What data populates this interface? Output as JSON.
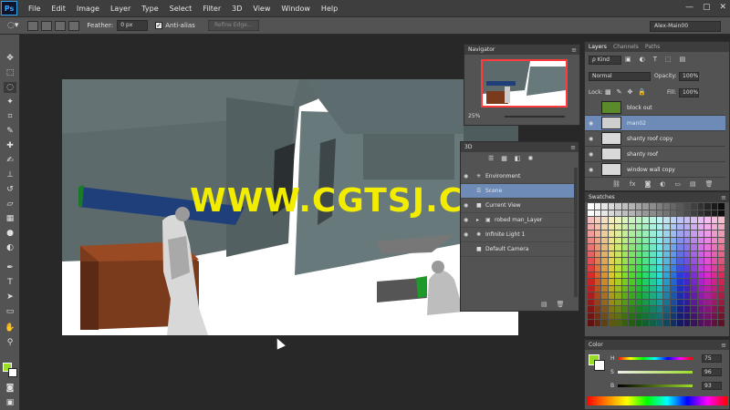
{
  "app": {
    "logo": "Ps"
  },
  "menu": [
    "File",
    "Edit",
    "Image",
    "Layer",
    "Type",
    "Select",
    "Filter",
    "3D",
    "View",
    "Window",
    "Help"
  ],
  "window_controls": [
    "—",
    "▢",
    "✕"
  ],
  "options": {
    "feather_label": "Feather:",
    "feather_value": "0 px",
    "antialias_label": "Anti-alias",
    "refine_label": "Refine Edge...",
    "workspace": "Alex-Main00"
  },
  "navigator": {
    "tab": "Navigator",
    "zoom": "25%"
  },
  "panel3d": {
    "tab": "3D",
    "rows": [
      {
        "label": "Environment",
        "icon": "globe-icon"
      },
      {
        "label": "Scene",
        "icon": "scene-icon"
      },
      {
        "label": "Current View",
        "icon": "camera-icon"
      },
      {
        "label": "robed man_Layer",
        "icon": "mesh-icon"
      },
      {
        "label": "Infinite Light 1",
        "icon": "light-icon"
      },
      {
        "label": "Default Camera",
        "icon": "camera-icon"
      }
    ]
  },
  "layers": {
    "tabs": [
      "Layers",
      "Channels",
      "Paths"
    ],
    "kind": "ρ Kind",
    "blend_mode": "Normal",
    "opacity_label": "Opacity:",
    "opacity": "100%",
    "lock_label": "Lock:",
    "fill_label": "Fill:",
    "fill": "100%",
    "rows": [
      {
        "name": "block out",
        "visible": false
      },
      {
        "name": "man02",
        "visible": true
      },
      {
        "name": "shanty roof copy",
        "visible": true
      },
      {
        "name": "shanty roof",
        "visible": true
      },
      {
        "name": "window wall copy",
        "visible": true
      }
    ]
  },
  "swatches": {
    "tab": "Swatches"
  },
  "color": {
    "tab": "Color",
    "h_label": "H",
    "h_value": "75",
    "s_label": "S",
    "s_value": "96",
    "b_label": "B",
    "b_value": "93",
    "fg_color": "#9bdc2b"
  },
  "watermark": "WWW.CGTSJ.COM"
}
